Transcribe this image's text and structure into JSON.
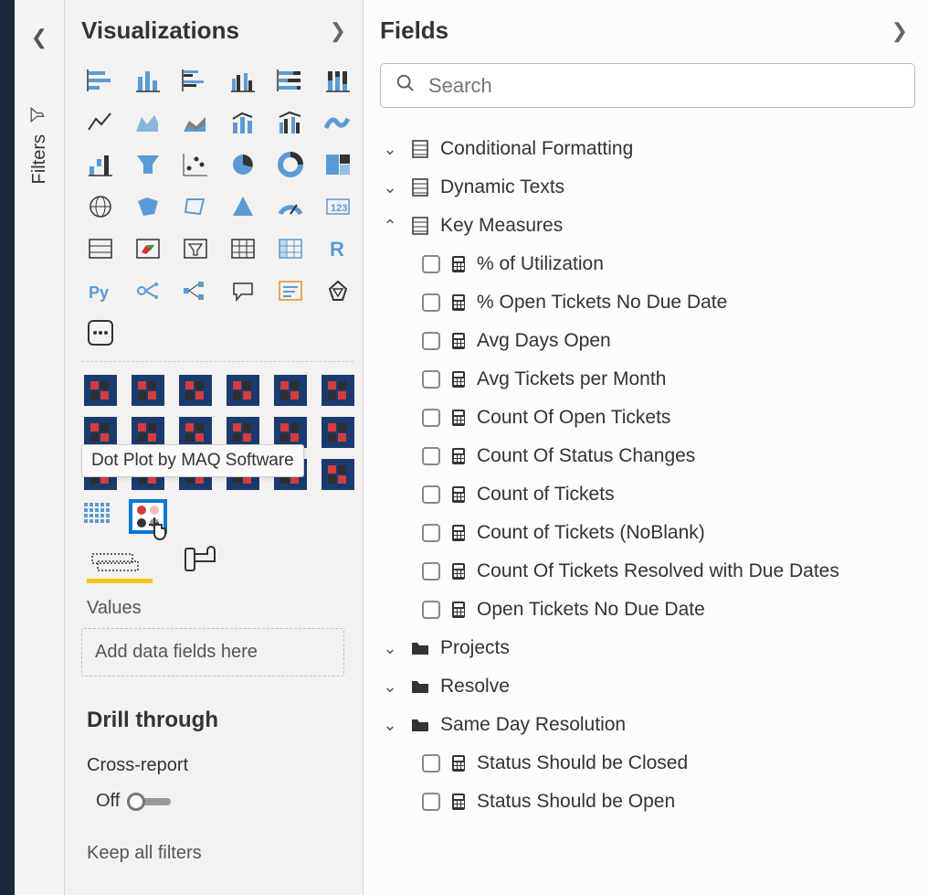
{
  "filters_rail": {
    "label": "Filters"
  },
  "visualizations": {
    "title": "Visualizations",
    "tooltip": "Dot Plot by MAQ Software",
    "values_label": "Values",
    "drop_placeholder": "Add data fields here",
    "drill_title": "Drill through",
    "cross_report_label": "Cross-report",
    "toggle_state": "Off",
    "keep_filters": "Keep all filters"
  },
  "fields": {
    "title": "Fields",
    "search_placeholder": "Search",
    "tables": [
      {
        "name": "Conditional Formatting",
        "expanded": false,
        "type": "table",
        "children": []
      },
      {
        "name": "Dynamic Texts",
        "expanded": false,
        "type": "table",
        "children": []
      },
      {
        "name": "Key Measures",
        "expanded": true,
        "type": "table",
        "children": [
          {
            "name": "% of Utilization"
          },
          {
            "name": "% Open Tickets No Due Date"
          },
          {
            "name": "Avg Days Open"
          },
          {
            "name": "Avg Tickets per Month"
          },
          {
            "name": "Count Of Open Tickets"
          },
          {
            "name": "Count Of Status Changes"
          },
          {
            "name": "Count of Tickets"
          },
          {
            "name": "Count of Tickets (NoBlank)"
          },
          {
            "name": "Count Of Tickets Resolved with Due Dates"
          },
          {
            "name": "Open Tickets No Due Date"
          }
        ]
      },
      {
        "name": "Projects",
        "expanded": false,
        "type": "folder",
        "children": []
      },
      {
        "name": "Resolve",
        "expanded": false,
        "type": "folder",
        "children": []
      },
      {
        "name": "Same Day Resolution",
        "expanded": false,
        "type": "folder",
        "children": [
          {
            "name": "Status Should be Closed"
          },
          {
            "name": "Status Should be Open"
          }
        ]
      }
    ]
  }
}
